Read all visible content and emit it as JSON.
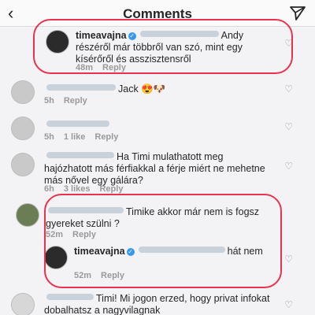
{
  "header": {
    "title": "Comments"
  },
  "comments": [
    {
      "user": "timeavajna",
      "text": "Andy részéről már többről van szó, mint egy kísérőről és asszisztensről",
      "time": "48m",
      "reply": "Reply"
    },
    {
      "text": "Jack 😍🐶",
      "time": "5h",
      "reply": "Reply"
    },
    {
      "time": "5h",
      "likes": "1 like",
      "reply": "Reply"
    },
    {
      "text": "Ha Timi mulathatott meg hajózhatott más férfiakkal a férje miért ne mehetne más nővel egy gálára?",
      "time": "6h",
      "likes": "3 likes",
      "reply": "Reply"
    },
    {
      "text": "Timike akkor már nem is fogsz gyereket szülni ?",
      "time": "52m",
      "reply": "Reply"
    },
    {
      "user": "timeavajna",
      "text": "hát nem",
      "time": "52m",
      "reply": "Reply"
    },
    {
      "text": "Timi! Mi jogon erzed, hogy privat infokat dobalhatsz a nagyvilagnak"
    }
  ]
}
